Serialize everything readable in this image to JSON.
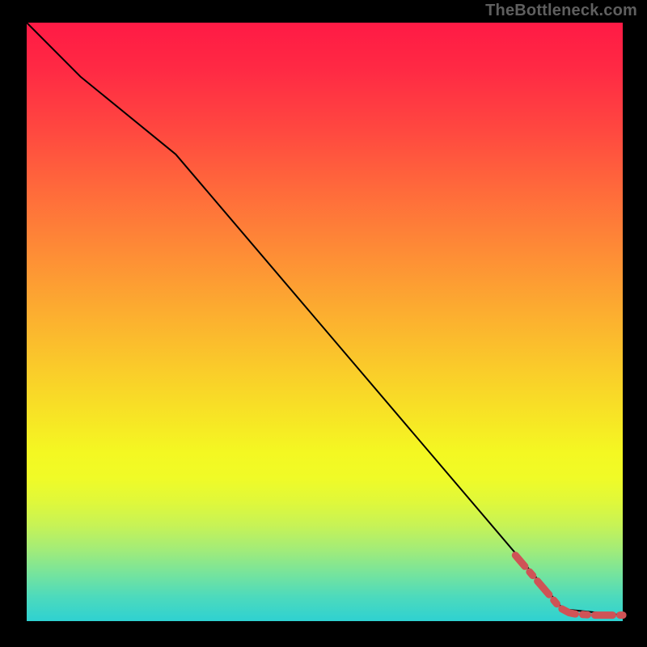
{
  "watermark": "TheBottleneck.com",
  "chart_data": {
    "type": "line",
    "title": "",
    "xlabel": "",
    "ylabel": "",
    "xlim": [
      0,
      100
    ],
    "ylim": [
      0,
      100
    ],
    "grid": false,
    "series": [
      {
        "name": "curve",
        "style": "solid-black",
        "x": [
          0,
          9,
          25,
          90,
          100
        ],
        "y": [
          100,
          91,
          78,
          2,
          1
        ]
      },
      {
        "name": "marked-tail",
        "style": "dashed-red-thick",
        "x": [
          82,
          88,
          89.5,
          91,
          92,
          93.5,
          95,
          96.5,
          98,
          100
        ],
        "y": [
          11,
          4,
          2.2,
          1.4,
          1.2,
          1.1,
          1.0,
          1.0,
          1.0,
          1.0
        ]
      }
    ],
    "points": [
      {
        "x": 100,
        "y": 1.0,
        "style": "red-dot"
      }
    ]
  },
  "colors": {
    "curve": "#000000",
    "marked": "#cf5356",
    "gradient_top": "#ff1a45",
    "gradient_bottom": "#2fd1d1"
  }
}
